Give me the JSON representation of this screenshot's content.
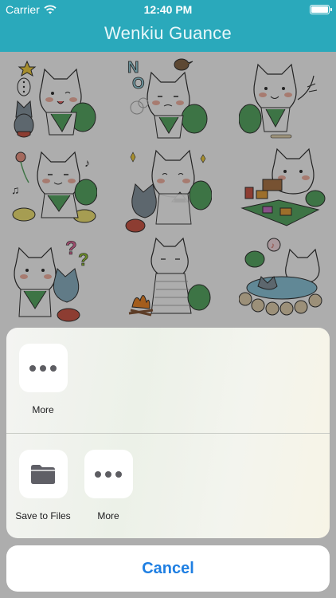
{
  "status_bar": {
    "carrier": "Carrier",
    "time": "12:40 PM",
    "battery_level": 1.0
  },
  "nav_bar": {
    "title": "Wenkiu Guance",
    "background": "#2aa9bb"
  },
  "share_sheet": {
    "top_row": [
      {
        "label": "More",
        "icon": "more-dots-icon"
      }
    ],
    "bottom_row": [
      {
        "label": "Save to Files",
        "icon": "folder-icon"
      },
      {
        "label": "More",
        "icon": "more-dots-icon"
      }
    ],
    "cancel_label": "Cancel",
    "accent": "#1f7fe2"
  },
  "sticker_grid": {
    "stickers": [
      "cat-speech-bubble-sticker",
      "cat-no-bird-sticker",
      "cat-hand-wave-sticker",
      "cat-flower-music-sticker",
      "cat-onigiri-sticker",
      "cat-picnic-sticker",
      "cat-question-sticker",
      "cat-campfire-sticker",
      "cat-hot-spring-sticker"
    ]
  }
}
